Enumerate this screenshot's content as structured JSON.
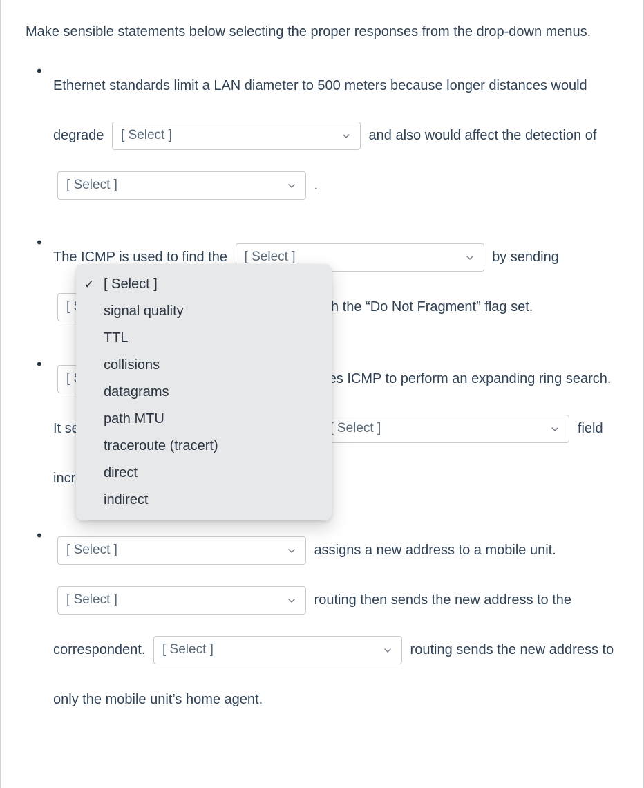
{
  "intro": "Make sensible statements below selecting the proper responses from the drop-down menus.",
  "select_placeholder": "[ Select ]",
  "bullets": [
    {
      "parts": [
        {
          "t": "text",
          "v": "Ethernet standards limit a LAN diameter to 500 meters because longer distances would degrade"
        },
        {
          "t": "select"
        },
        {
          "t": "text",
          "v": "and also would affect the detection of"
        },
        {
          "t": "select"
        },
        {
          "t": "text",
          "v": "."
        }
      ]
    },
    {
      "parts": [
        {
          "t": "text",
          "v": "The ICMP is used to find the"
        },
        {
          "t": "select"
        },
        {
          "t": "text",
          "v": "by sending"
        },
        {
          "t": "select"
        },
        {
          "t": "text",
          "v": "with the “Do Not Fragment” flag set."
        }
      ]
    },
    {
      "parts": [
        {
          "t": "select"
        },
        {
          "t": "text",
          "v": "uses ICMP to perform an expanding ring search. It sends a sequence of datagrams with the"
        },
        {
          "t": "select"
        },
        {
          "t": "text",
          "v": "field incremented in each successive"
        }
      ]
    },
    {
      "parts": [
        {
          "t": "select"
        },
        {
          "t": "text",
          "v": "assigns a new address to a mobile unit."
        },
        {
          "t": "select"
        },
        {
          "t": "text",
          "v": "routing then sends the new address to the correspondent."
        },
        {
          "t": "select"
        },
        {
          "t": "text",
          "v": "routing sends the new address to only the mobile unit’s home agent."
        }
      ]
    }
  ],
  "dropdown_options": [
    {
      "label": "[ Select ]",
      "checked": true
    },
    {
      "label": "signal quality",
      "checked": false
    },
    {
      "label": "TTL",
      "checked": false
    },
    {
      "label": "collisions",
      "checked": false
    },
    {
      "label": "datagrams",
      "checked": false
    },
    {
      "label": "path MTU",
      "checked": false
    },
    {
      "label": "traceroute (tracert)",
      "checked": false
    },
    {
      "label": "direct",
      "checked": false
    },
    {
      "label": "indirect",
      "checked": false
    }
  ]
}
